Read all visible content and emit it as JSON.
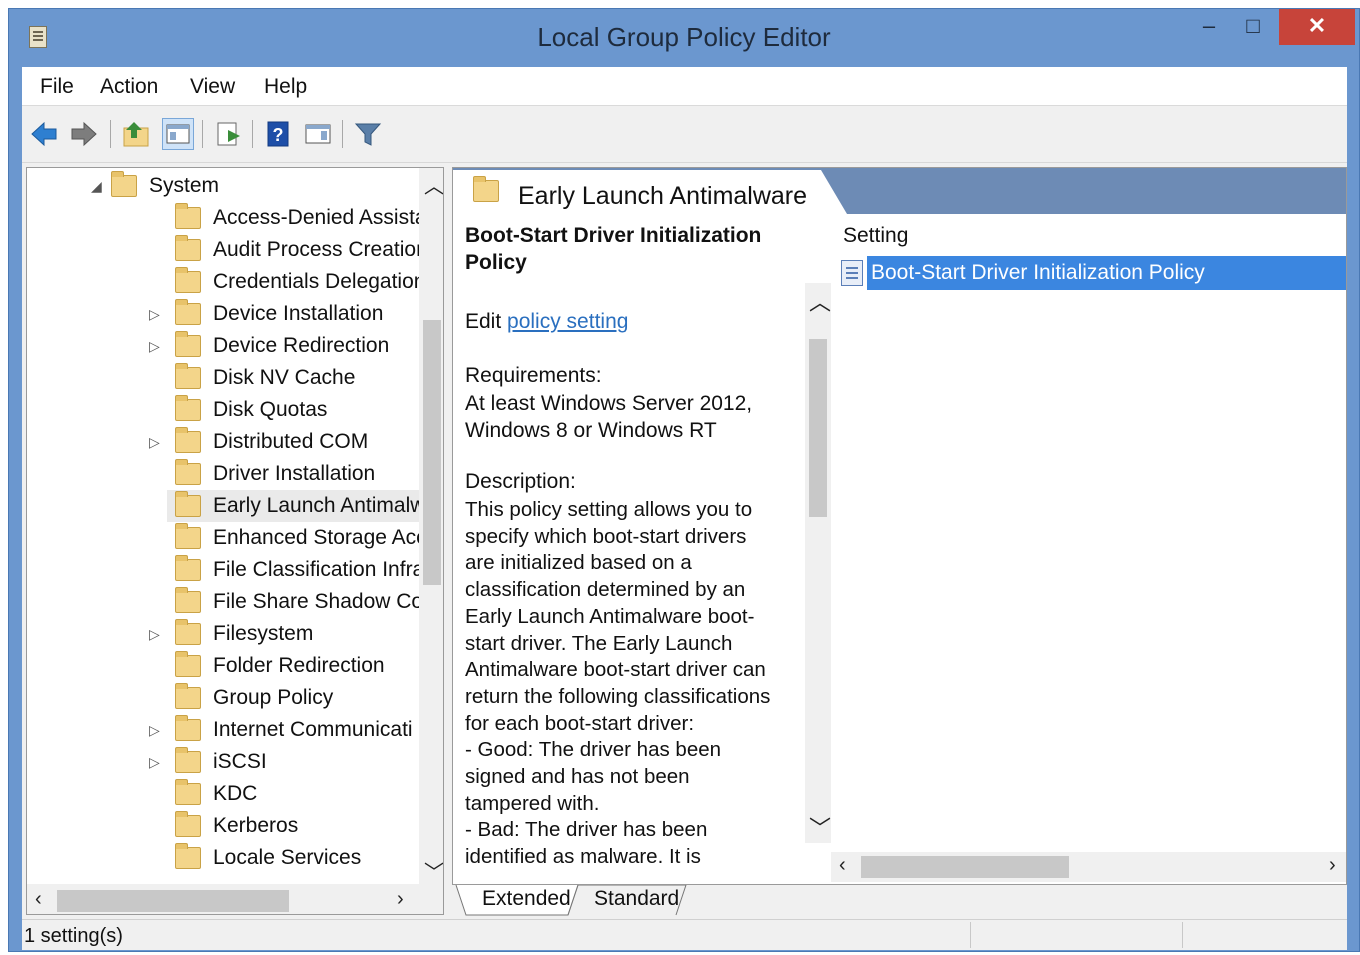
{
  "window": {
    "title": "Local Group Policy Editor",
    "minimize_glyph": "–",
    "maximize_glyph": "□",
    "close_glyph": "✕"
  },
  "menu": {
    "file": "File",
    "action": "Action",
    "view": "View",
    "help": "Help"
  },
  "tree": {
    "root": "System",
    "items": [
      "Access-Denied Assista",
      "Audit Process Creatior",
      "Credentials Delegation",
      "Device Installation",
      "Device Redirection",
      "Disk NV Cache",
      "Disk Quotas",
      "Distributed COM",
      "Driver Installation",
      "Early Launch Antimalw",
      "Enhanced Storage Acc",
      "File Classification Infra",
      "File Share Shadow Cop",
      "Filesystem",
      "Folder Redirection",
      "Group Policy",
      "Internet Communicati",
      "iSCSI",
      "KDC",
      "Kerberos",
      "Locale Services"
    ]
  },
  "right": {
    "header": "Early Launch Antimalware",
    "policy_title": "Boot-Start Driver Initialization Policy",
    "edit_prefix": "Edit",
    "edit_link": "policy setting",
    "requirements_label": "Requirements:",
    "requirements_text": "At least Windows Server 2012, Windows 8 or Windows RT",
    "description_label": "Description:",
    "description_text": "This policy setting allows you to\nspecify which boot-start drivers\nare initialized based on a\nclassification determined by an\nEarly Launch Antimalware boot-\nstart driver. The Early Launch\nAntimalware boot-start driver can\nreturn the following classifications\nfor each boot-start driver:\n-  Good: The driver has been\nsigned and has not been\ntampered with.\n-  Bad: The driver has been\nidentified as malware. It is",
    "column_setting": "Setting",
    "settings": [
      "Boot-Start Driver Initialization Policy"
    ]
  },
  "tabs": {
    "extended": "Extended",
    "standard": "Standard"
  },
  "status": {
    "text": "1 setting(s)"
  },
  "colors": {
    "title_bar": "#6b97cf",
    "close_button": "#c7443a",
    "selection": "#3b86e0",
    "link": "#2a6fbf",
    "folder": "#f3d58a"
  },
  "toolbar_icons": [
    "back-arrow-icon",
    "forward-arrow-icon",
    "up-folder-icon",
    "show-hide-tree-icon",
    "export-list-icon",
    "help-icon",
    "show-hide-action-pane-icon",
    "filter-icon"
  ]
}
